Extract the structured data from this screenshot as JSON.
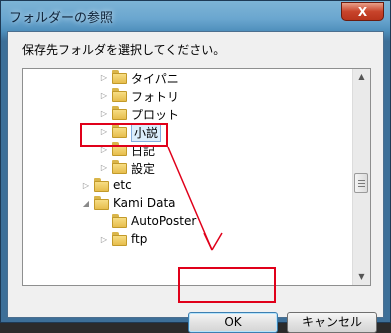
{
  "window": {
    "title": "フォルダーの参照",
    "close_label": "X"
  },
  "instruction": "保存先フォルダを選択してください。",
  "tree": {
    "items": [
      {
        "label": "タイパニ",
        "level": 2,
        "expander": "▷",
        "selected": false
      },
      {
        "label": "フォトリ",
        "level": 2,
        "expander": "▷",
        "selected": false
      },
      {
        "label": "プロット",
        "level": 2,
        "expander": "▷",
        "selected": false
      },
      {
        "label": "小説",
        "level": 2,
        "expander": "▷",
        "selected": true
      },
      {
        "label": "日記",
        "level": 2,
        "expander": "▷",
        "selected": false
      },
      {
        "label": "設定",
        "level": 2,
        "expander": "▷",
        "selected": false
      },
      {
        "label": "etc",
        "level": 1,
        "expander": "▷",
        "selected": false
      },
      {
        "label": "Kami Data",
        "level": 1,
        "expander": "◢",
        "selected": false
      },
      {
        "label": "AutoPoster",
        "level": 2,
        "expander": "",
        "selected": false
      },
      {
        "label": "ftp",
        "level": 2,
        "expander": "▷",
        "selected": false
      }
    ]
  },
  "buttons": {
    "ok": "OK",
    "cancel": "キャンセル"
  },
  "colors": {
    "highlight": "#e0001a",
    "selection": "#dceefc"
  }
}
